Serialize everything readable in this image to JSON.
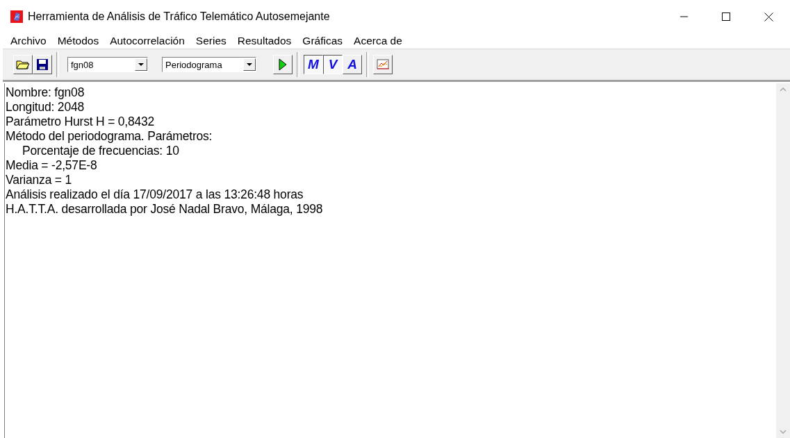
{
  "window": {
    "title": "Herramienta de Análisis de Tráfico Telemático Autosemejante"
  },
  "menu": [
    "Archivo",
    "Métodos",
    "Autocorrelación",
    "Series",
    "Resultados",
    "Gráficas",
    "Acerca de"
  ],
  "toolbar": {
    "series_select": {
      "value": "fgn08"
    },
    "method_select": {
      "value": "Periodograma"
    },
    "toggles": [
      {
        "label": "M",
        "selected": true
      },
      {
        "label": "V",
        "selected": true
      },
      {
        "label": "A",
        "selected": false
      }
    ]
  },
  "results": [
    {
      "text": "Nombre: fgn08",
      "indented": false
    },
    {
      "text": "Longitud: 2048",
      "indented": false
    },
    {
      "text": "Parámetro Hurst H = 0,8432",
      "indented": false
    },
    {
      "text": "Método del periodograma. Parámetros:",
      "indented": false
    },
    {
      "text": "Porcentaje de frecuencias: 10",
      "indented": true
    },
    {
      "text": "Media = -2,57E-8",
      "indented": false
    },
    {
      "text": "Varianza = 1",
      "indented": false
    },
    {
      "text": "Análisis realizado el día 17/09/2017 a las 13:26:48 horas",
      "indented": false
    },
    {
      "text": "H.A.T.T.A. desarrollada por José Nadal Bravo, Málaga, 1998",
      "indented": false
    }
  ]
}
